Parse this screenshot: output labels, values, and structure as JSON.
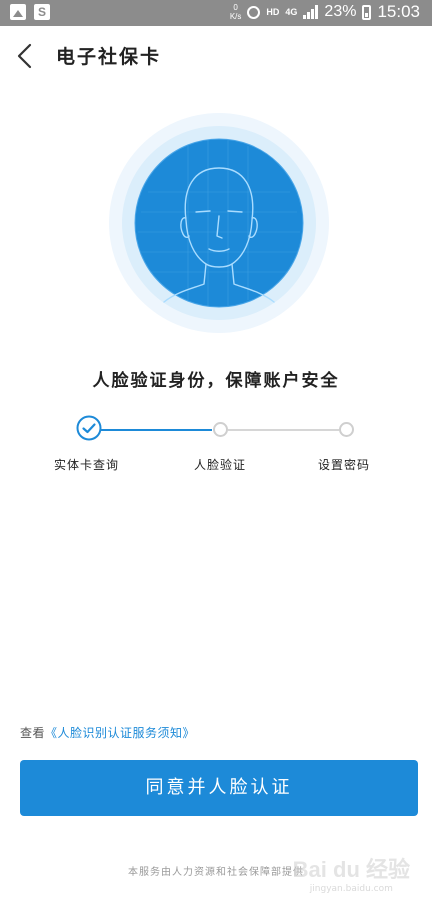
{
  "status_bar": {
    "net_speed_value": "0",
    "net_speed_unit": "K/s",
    "hd": "HD",
    "network": "4G",
    "battery_percent": "23%",
    "time": "15:03",
    "app_icon_letter": "S"
  },
  "header": {
    "title": "电子社保卡"
  },
  "slogan": "人脸验证身份，保障账户安全",
  "stepper": {
    "steps": [
      {
        "label": "实体卡查询",
        "state": "done"
      },
      {
        "label": "人脸验证",
        "state": "current"
      },
      {
        "label": "设置密码",
        "state": "todo"
      }
    ]
  },
  "notice": {
    "prefix": "查看",
    "link": "《人脸识别认证服务须知》"
  },
  "primary_button": {
    "label": "同意并人脸认证"
  },
  "footer": {
    "note": "本服务由人力资源和社会保障部提供"
  },
  "watermark": {
    "main": "Bai du 经验",
    "sub": "jingyan.baidu.com"
  },
  "colors": {
    "accent": "#1d8ad8",
    "status_bar": "#8c8c8c"
  }
}
